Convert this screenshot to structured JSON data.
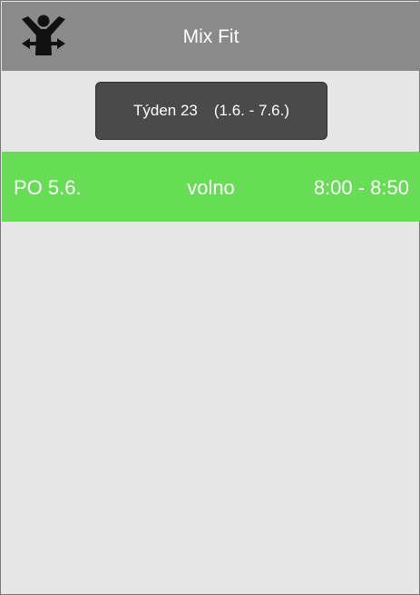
{
  "app": {
    "title": "Mix Fit",
    "logo_icon": "person-arms-raised-icon"
  },
  "week_selector": {
    "week_label": "Týden 23",
    "date_range": "(1.6. - 7.6.)"
  },
  "slots": [
    {
      "day": "PO 5.6.",
      "status": "volno",
      "time": "8:00 - 8:50",
      "color": "#66dd55"
    }
  ],
  "colors": {
    "appbar": "#8a8a8a",
    "background": "#e6e6e6",
    "button": "#4a4a4a",
    "available": "#66dd55"
  }
}
